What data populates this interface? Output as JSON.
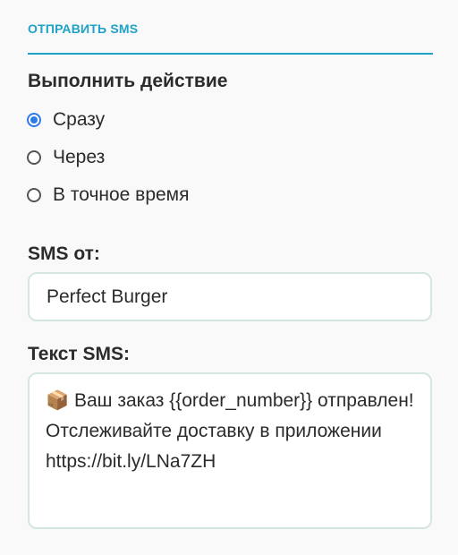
{
  "section": {
    "title": "ОТПРАВИТЬ SMS",
    "accent_color": "#1ea2c7"
  },
  "action": {
    "label": "Выполнить действие",
    "options": [
      {
        "label": "Сразу",
        "checked": true
      },
      {
        "label": "Через",
        "checked": false
      },
      {
        "label": "В точное время",
        "checked": false
      }
    ],
    "selected_color": "#2f7be6"
  },
  "sender": {
    "label": "SMS от:",
    "value": "Perfect Burger"
  },
  "message": {
    "label": "Текст SMS:",
    "icon": "package-icon",
    "icon_glyph": "📦",
    "value": "Ваш заказ {{order_number}} отправлен! Отслеживайте доставку в приложении https://bit.ly/LNa7ZH"
  }
}
